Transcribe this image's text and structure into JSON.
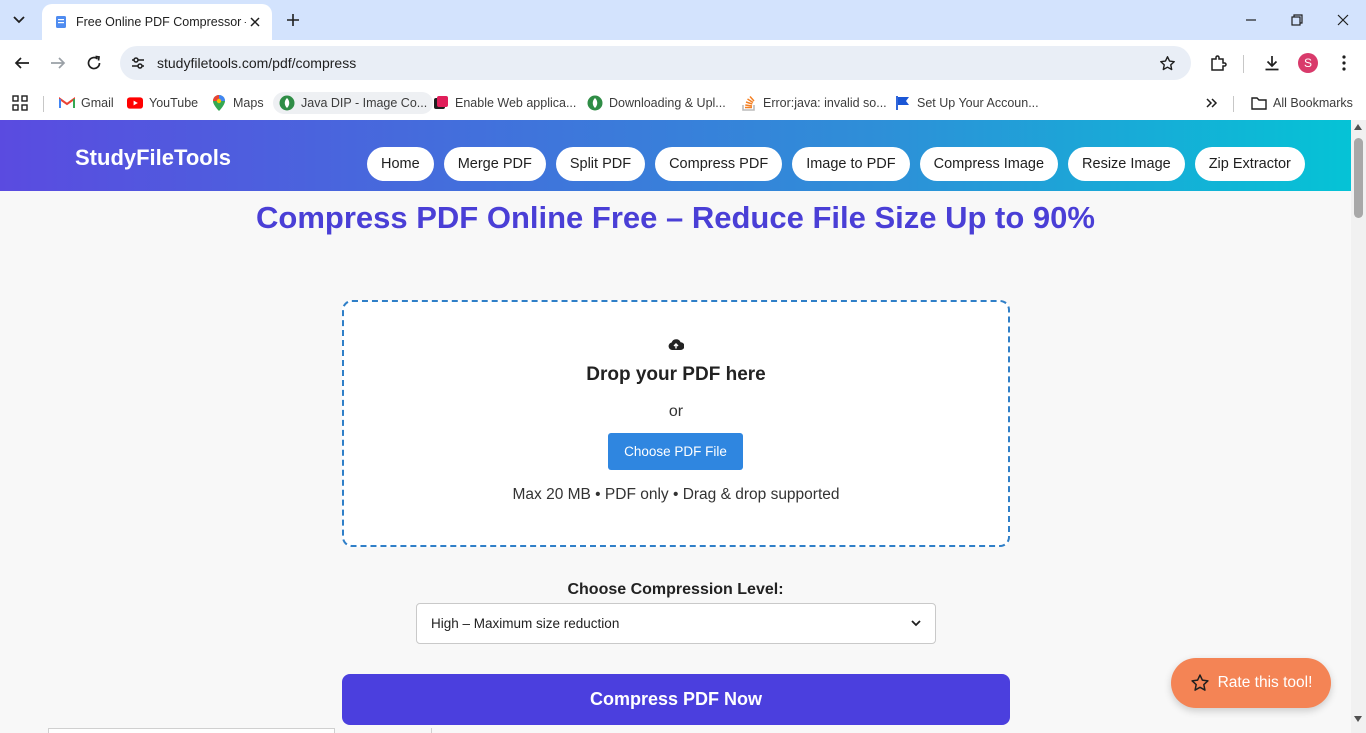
{
  "browser": {
    "tab_title": "Free Online PDF Compressor – Reduce PDF Size",
    "url": "studyfiletools.com/pdf/compress",
    "profile_initial": "S",
    "bookmarks": [
      {
        "label": "Gmail",
        "icon": "gmail-icon"
      },
      {
        "label": "YouTube",
        "icon": "youtube-icon"
      },
      {
        "label": "Maps",
        "icon": "maps-icon"
      },
      {
        "label": "Java DIP - Image Co...",
        "icon": "green-leaf-icon"
      },
      {
        "label": "Enable Web applica...",
        "icon": "app-icon"
      },
      {
        "label": "Downloading & Upl...",
        "icon": "green-leaf-icon"
      },
      {
        "label": "Error:java: invalid so...",
        "icon": "stackoverflow-icon"
      },
      {
        "label": "Set Up Your Accoun...",
        "icon": "flag-icon"
      }
    ],
    "all_bookmarks_label": "All Bookmarks"
  },
  "site": {
    "brand": "StudyFileTools",
    "nav": [
      "Home",
      "Merge PDF",
      "Split PDF",
      "Compress PDF",
      "Image to PDF",
      "Compress Image",
      "Resize Image",
      "Zip Extractor"
    ]
  },
  "main": {
    "headline": "Compress PDF Online Free – Reduce File Size Up to 90%",
    "dropzone": {
      "icon": "cloud-upload-icon",
      "title": "Drop your PDF here",
      "or": "or",
      "button": "Choose PDF File",
      "note": "Max 20 MB • PDF only • Drag & drop supported"
    },
    "level_label": "Choose Compression Level:",
    "level_selected": "High – Maximum size reduction",
    "compress_button": "Compress PDF Now",
    "rate_button": "Rate this tool!"
  },
  "colors": {
    "header_gradient_start": "#5a4be0",
    "header_gradient_end": "#05c3d6",
    "headline": "#4a3fd6",
    "primary_button": "#4b3fde",
    "choose_button": "#2f86e0",
    "rate_button": "#f48455",
    "dropzone_border": "#2f7fc8"
  }
}
